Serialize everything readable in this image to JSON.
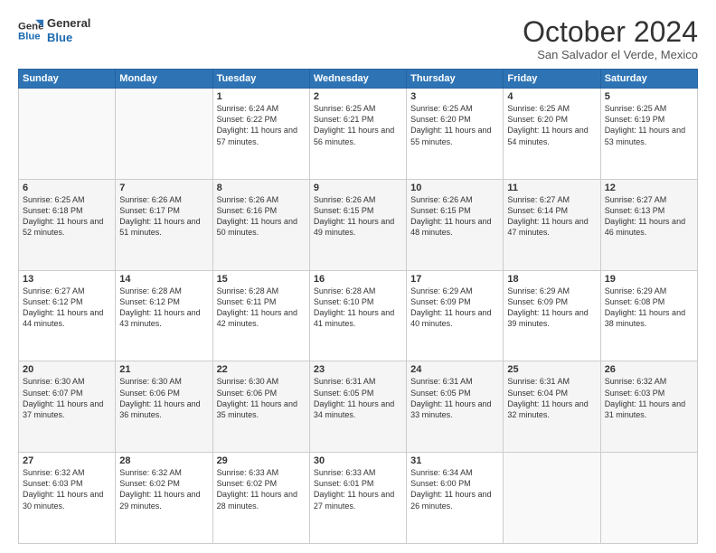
{
  "header": {
    "logo_line1": "General",
    "logo_line2": "Blue",
    "month": "October 2024",
    "location": "San Salvador el Verde, Mexico"
  },
  "weekdays": [
    "Sunday",
    "Monday",
    "Tuesday",
    "Wednesday",
    "Thursday",
    "Friday",
    "Saturday"
  ],
  "weeks": [
    [
      {
        "day": "",
        "info": ""
      },
      {
        "day": "",
        "info": ""
      },
      {
        "day": "1",
        "info": "Sunrise: 6:24 AM\nSunset: 6:22 PM\nDaylight: 11 hours and 57 minutes."
      },
      {
        "day": "2",
        "info": "Sunrise: 6:25 AM\nSunset: 6:21 PM\nDaylight: 11 hours and 56 minutes."
      },
      {
        "day": "3",
        "info": "Sunrise: 6:25 AM\nSunset: 6:20 PM\nDaylight: 11 hours and 55 minutes."
      },
      {
        "day": "4",
        "info": "Sunrise: 6:25 AM\nSunset: 6:20 PM\nDaylight: 11 hours and 54 minutes."
      },
      {
        "day": "5",
        "info": "Sunrise: 6:25 AM\nSunset: 6:19 PM\nDaylight: 11 hours and 53 minutes."
      }
    ],
    [
      {
        "day": "6",
        "info": "Sunrise: 6:25 AM\nSunset: 6:18 PM\nDaylight: 11 hours and 52 minutes."
      },
      {
        "day": "7",
        "info": "Sunrise: 6:26 AM\nSunset: 6:17 PM\nDaylight: 11 hours and 51 minutes."
      },
      {
        "day": "8",
        "info": "Sunrise: 6:26 AM\nSunset: 6:16 PM\nDaylight: 11 hours and 50 minutes."
      },
      {
        "day": "9",
        "info": "Sunrise: 6:26 AM\nSunset: 6:15 PM\nDaylight: 11 hours and 49 minutes."
      },
      {
        "day": "10",
        "info": "Sunrise: 6:26 AM\nSunset: 6:15 PM\nDaylight: 11 hours and 48 minutes."
      },
      {
        "day": "11",
        "info": "Sunrise: 6:27 AM\nSunset: 6:14 PM\nDaylight: 11 hours and 47 minutes."
      },
      {
        "day": "12",
        "info": "Sunrise: 6:27 AM\nSunset: 6:13 PM\nDaylight: 11 hours and 46 minutes."
      }
    ],
    [
      {
        "day": "13",
        "info": "Sunrise: 6:27 AM\nSunset: 6:12 PM\nDaylight: 11 hours and 44 minutes."
      },
      {
        "day": "14",
        "info": "Sunrise: 6:28 AM\nSunset: 6:12 PM\nDaylight: 11 hours and 43 minutes."
      },
      {
        "day": "15",
        "info": "Sunrise: 6:28 AM\nSunset: 6:11 PM\nDaylight: 11 hours and 42 minutes."
      },
      {
        "day": "16",
        "info": "Sunrise: 6:28 AM\nSunset: 6:10 PM\nDaylight: 11 hours and 41 minutes."
      },
      {
        "day": "17",
        "info": "Sunrise: 6:29 AM\nSunset: 6:09 PM\nDaylight: 11 hours and 40 minutes."
      },
      {
        "day": "18",
        "info": "Sunrise: 6:29 AM\nSunset: 6:09 PM\nDaylight: 11 hours and 39 minutes."
      },
      {
        "day": "19",
        "info": "Sunrise: 6:29 AM\nSunset: 6:08 PM\nDaylight: 11 hours and 38 minutes."
      }
    ],
    [
      {
        "day": "20",
        "info": "Sunrise: 6:30 AM\nSunset: 6:07 PM\nDaylight: 11 hours and 37 minutes."
      },
      {
        "day": "21",
        "info": "Sunrise: 6:30 AM\nSunset: 6:06 PM\nDaylight: 11 hours and 36 minutes."
      },
      {
        "day": "22",
        "info": "Sunrise: 6:30 AM\nSunset: 6:06 PM\nDaylight: 11 hours and 35 minutes."
      },
      {
        "day": "23",
        "info": "Sunrise: 6:31 AM\nSunset: 6:05 PM\nDaylight: 11 hours and 34 minutes."
      },
      {
        "day": "24",
        "info": "Sunrise: 6:31 AM\nSunset: 6:05 PM\nDaylight: 11 hours and 33 minutes."
      },
      {
        "day": "25",
        "info": "Sunrise: 6:31 AM\nSunset: 6:04 PM\nDaylight: 11 hours and 32 minutes."
      },
      {
        "day": "26",
        "info": "Sunrise: 6:32 AM\nSunset: 6:03 PM\nDaylight: 11 hours and 31 minutes."
      }
    ],
    [
      {
        "day": "27",
        "info": "Sunrise: 6:32 AM\nSunset: 6:03 PM\nDaylight: 11 hours and 30 minutes."
      },
      {
        "day": "28",
        "info": "Sunrise: 6:32 AM\nSunset: 6:02 PM\nDaylight: 11 hours and 29 minutes."
      },
      {
        "day": "29",
        "info": "Sunrise: 6:33 AM\nSunset: 6:02 PM\nDaylight: 11 hours and 28 minutes."
      },
      {
        "day": "30",
        "info": "Sunrise: 6:33 AM\nSunset: 6:01 PM\nDaylight: 11 hours and 27 minutes."
      },
      {
        "day": "31",
        "info": "Sunrise: 6:34 AM\nSunset: 6:00 PM\nDaylight: 11 hours and 26 minutes."
      },
      {
        "day": "",
        "info": ""
      },
      {
        "day": "",
        "info": ""
      }
    ]
  ]
}
